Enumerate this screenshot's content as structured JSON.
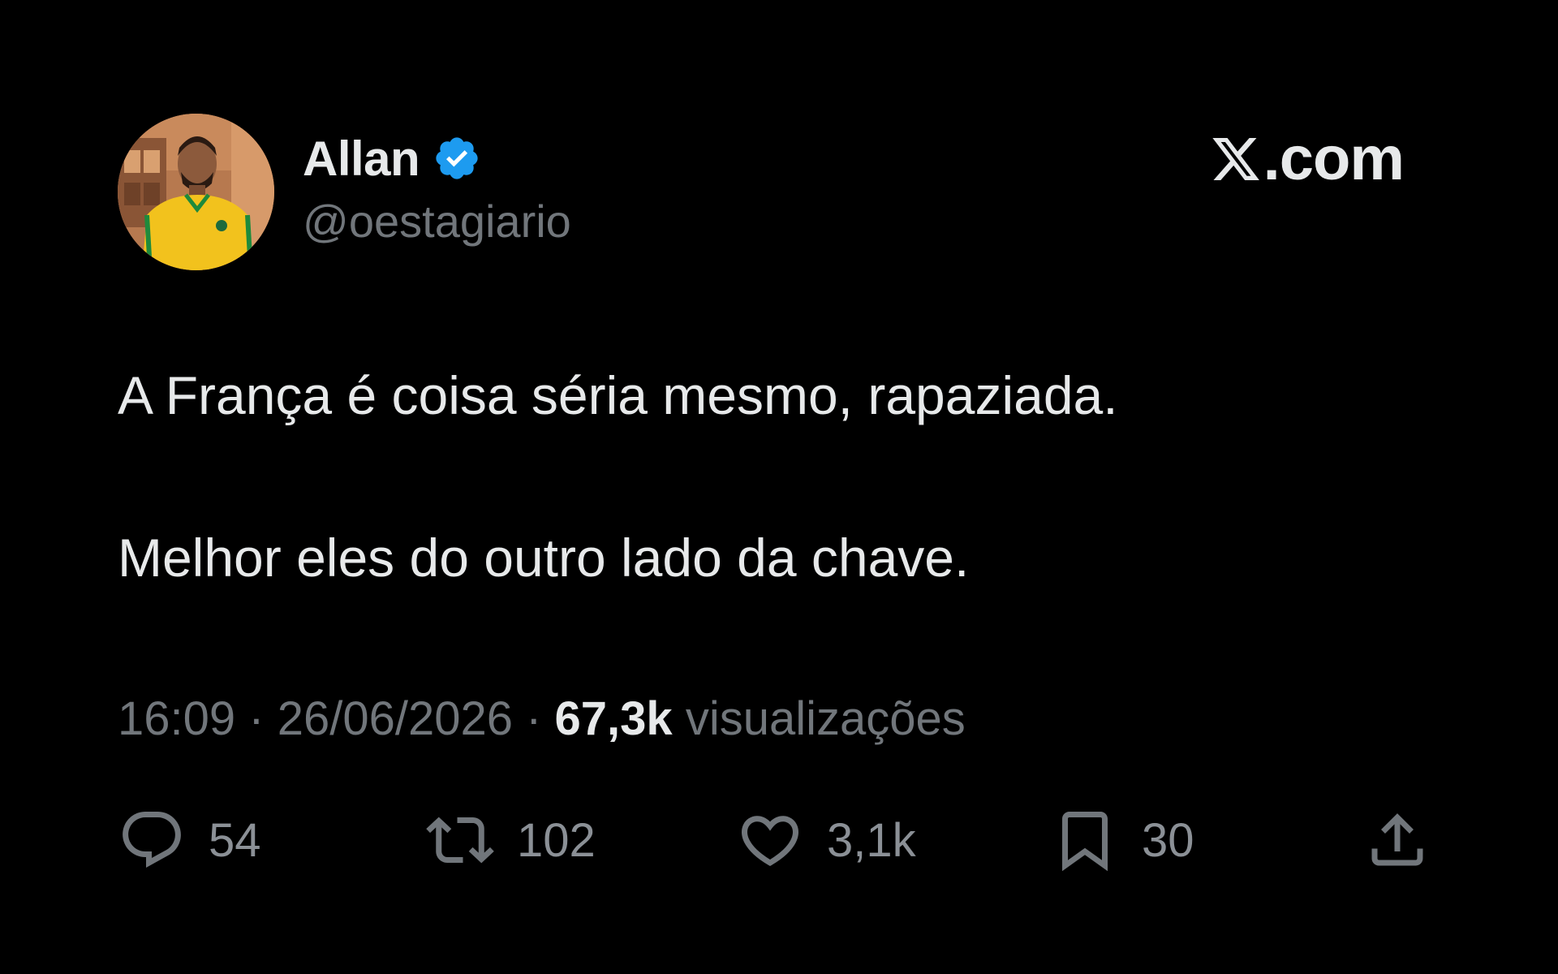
{
  "author": {
    "display_name": "Allan",
    "handle": "@oestagiario",
    "verified": true,
    "verified_icon": "verified-badge-icon",
    "verified_color": "#1d9bf0"
  },
  "brand": {
    "icon": "x-logo-icon",
    "suffix": ".com"
  },
  "tweet": {
    "lines": [
      "A França é coisa séria mesmo, rapaziada.",
      "Melhor eles do outro lado da chave."
    ]
  },
  "meta": {
    "time": "16:09",
    "separator": " · ",
    "date": "26/06/2026",
    "views_count": "67,3k",
    "views_label": "visualizações"
  },
  "actions": {
    "reply": {
      "icon": "reply-icon",
      "count": "54"
    },
    "retweet": {
      "icon": "retweet-icon",
      "count": "102"
    },
    "like": {
      "icon": "heart-icon",
      "count": "3,1k"
    },
    "bookmark": {
      "icon": "bookmark-icon",
      "count": "30"
    },
    "share": {
      "icon": "share-icon"
    }
  },
  "colors": {
    "background": "#000000",
    "primary_text": "#e7e9ea",
    "secondary_text": "#71767b"
  }
}
